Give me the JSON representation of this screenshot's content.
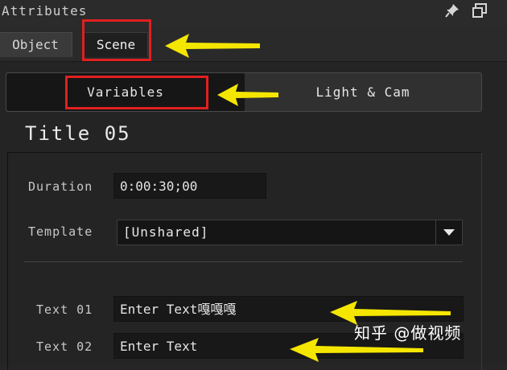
{
  "panel": {
    "title": "Attributes",
    "pin_icon": "pin-icon",
    "float_icon": "float-window-icon"
  },
  "tabs": [
    {
      "label": "Object",
      "active": false
    },
    {
      "label": "Scene",
      "active": true
    }
  ],
  "segments": [
    {
      "label": "Variables",
      "active": true
    },
    {
      "label": "Light & Cam",
      "active": false
    }
  ],
  "section": {
    "title": "Title 05"
  },
  "fields": {
    "duration": {
      "label": "Duration",
      "value": "0:00:30;00"
    },
    "template": {
      "label": "Template",
      "value": "[Unshared]",
      "dropdown_icon": "triangle-down-icon"
    },
    "text01": {
      "label": "Text 01",
      "value": "Enter Text嘎嘎嘎"
    },
    "text02": {
      "label": "Text 02",
      "value": "Enter Text"
    }
  },
  "annotations": {
    "highlight_color": "#e02020",
    "arrow_color": "#f5e600"
  },
  "watermark": "知乎 @做视频"
}
